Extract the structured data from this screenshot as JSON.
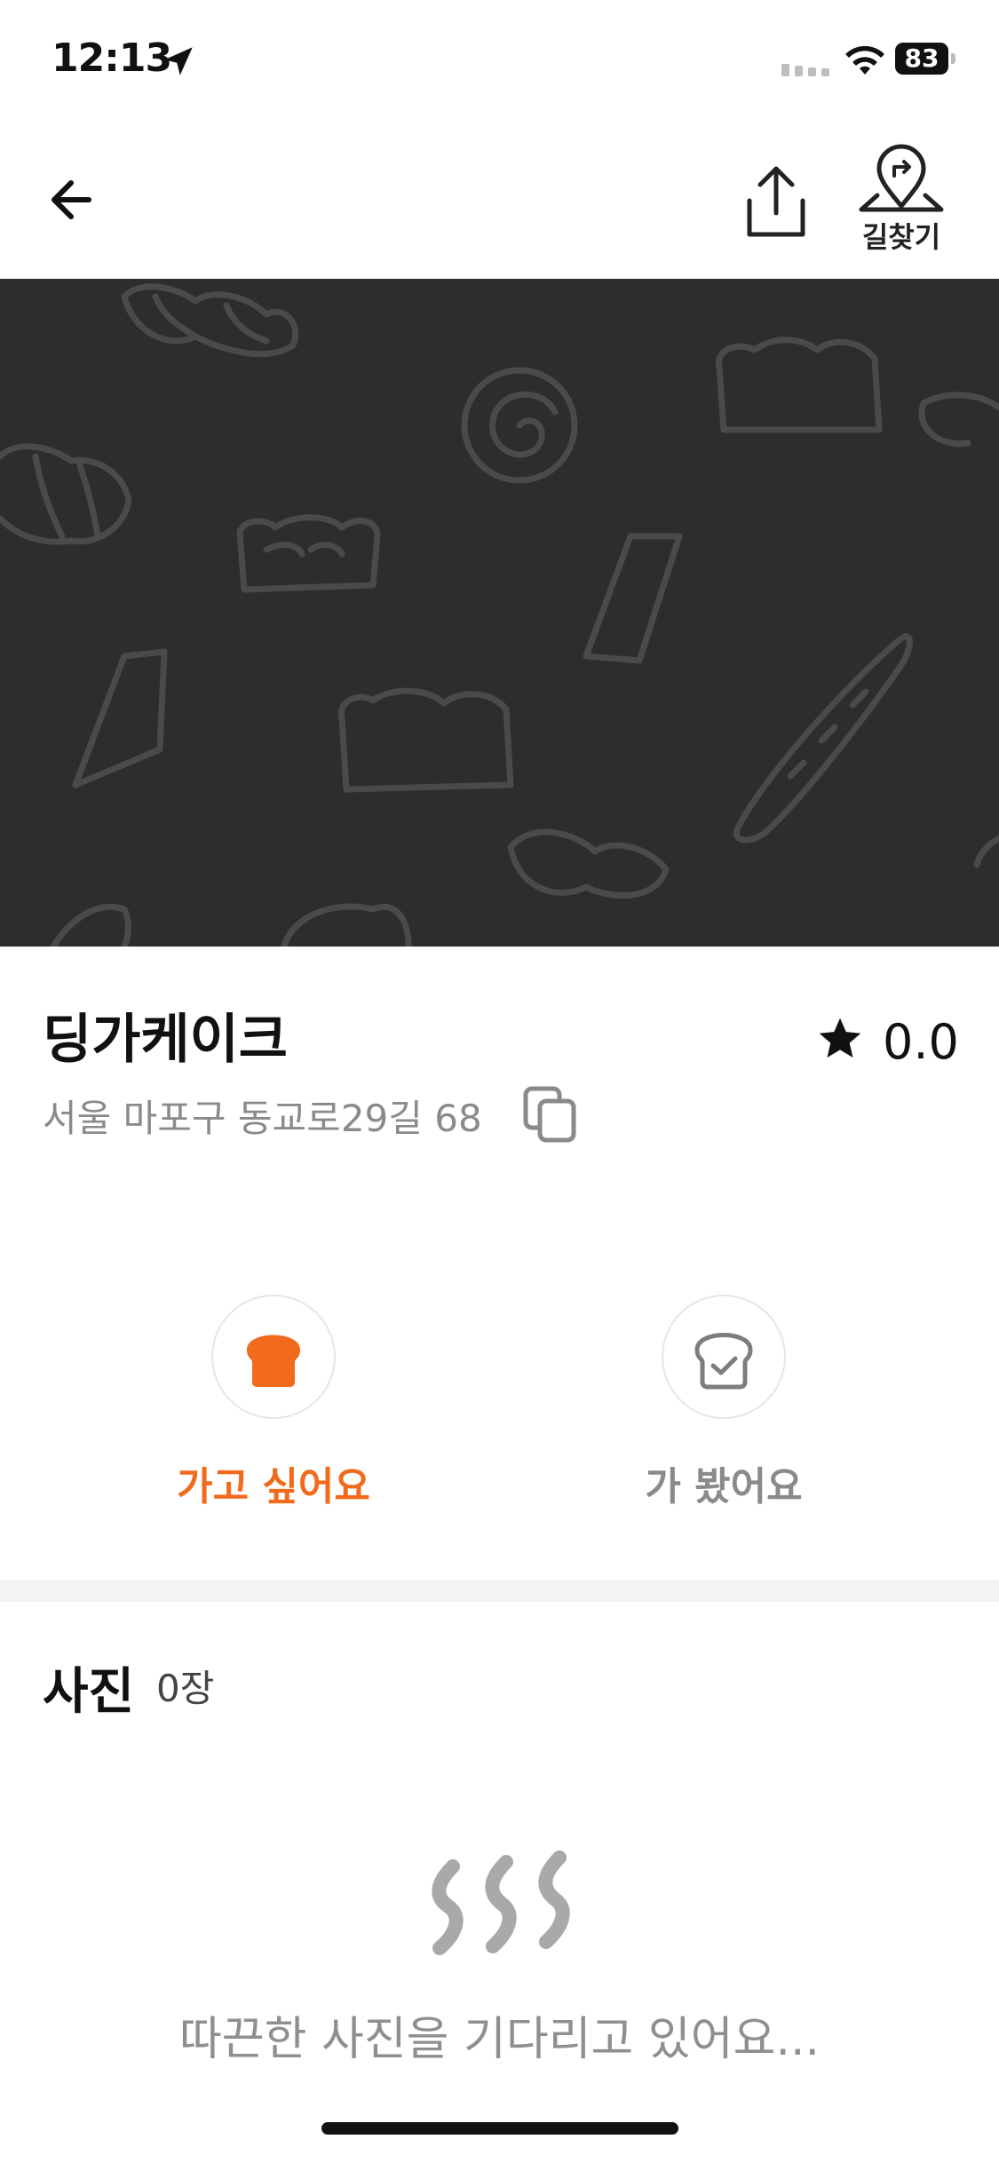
{
  "status_bar": {
    "time": "12:13",
    "battery": "83"
  },
  "nav": {
    "directions_label": "길찾기"
  },
  "shop": {
    "name": "딩가케이크",
    "rating": "0.0",
    "address": "서울 마포구 동교로29길 68"
  },
  "actions": {
    "want_to_go": "가고 싶어요",
    "visited": "가 봤어요"
  },
  "photos": {
    "title": "사진",
    "count": "0장",
    "empty_message": "따끈한 사진을 기다리고 있어요..."
  },
  "colors": {
    "accent": "#f26a1b",
    "hero_bg": "#2d2d2d",
    "muted_text": "#8a8a8a"
  },
  "icons": {
    "back": "arrow-left-icon",
    "share": "share-icon",
    "directions": "map-pin-route-icon",
    "rating": "star-icon",
    "copy": "copy-icon",
    "want": "bread-icon",
    "visited": "bread-check-icon"
  }
}
